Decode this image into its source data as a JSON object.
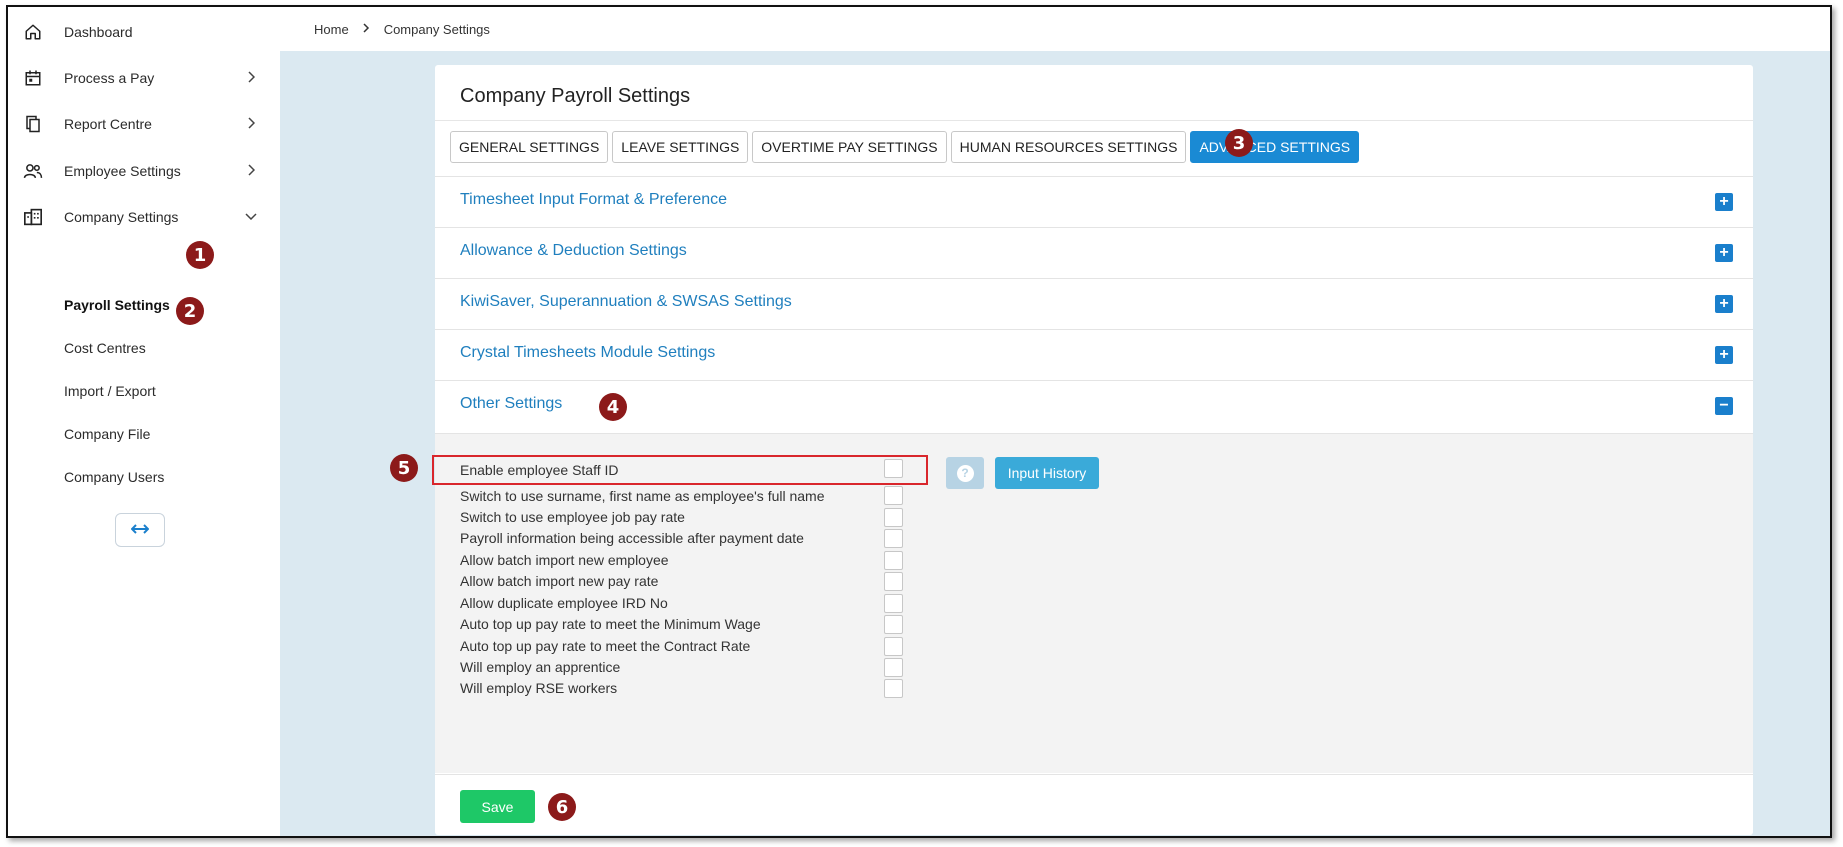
{
  "sidebar": {
    "items": [
      {
        "label": "Dashboard",
        "icon": "home-icon"
      },
      {
        "label": "Process a Pay",
        "icon": "calendar-icon"
      },
      {
        "label": "Report Centre",
        "icon": "documents-icon"
      },
      {
        "label": "Employee Settings",
        "icon": "people-icon"
      },
      {
        "label": "Company Settings",
        "icon": "building-icon"
      }
    ],
    "sub_items": [
      {
        "label": "Payroll Settings"
      },
      {
        "label": "Cost Centres"
      },
      {
        "label": "Import / Export"
      },
      {
        "label": "Company File"
      },
      {
        "label": "Company Users"
      }
    ],
    "collapse_icon": "double-arrow-icon"
  },
  "breadcrumb": {
    "home": "Home",
    "current": "Company Settings"
  },
  "card": {
    "title": "Company Payroll Settings",
    "tabs": [
      {
        "label": "GENERAL SETTINGS"
      },
      {
        "label": "LEAVE SETTINGS"
      },
      {
        "label": "OVERTIME PAY SETTINGS"
      },
      {
        "label": "HUMAN RESOURCES SETTINGS"
      },
      {
        "label": "ADVANCED SETTINGS"
      }
    ],
    "active_tab": "ADVANCED SETTINGS",
    "sections": [
      {
        "title": "Timesheet Input Format & Preference",
        "toggle": "+"
      },
      {
        "title": "Allowance & Deduction Settings",
        "toggle": "+"
      },
      {
        "title": "KiwiSaver, Superannuation & SWSAS Settings",
        "toggle": "+"
      },
      {
        "title": "Crystal Timesheets Module Settings",
        "toggle": "+"
      },
      {
        "title": "Other Settings",
        "toggle": "−"
      }
    ],
    "options": [
      {
        "label": "Enable employee Staff ID",
        "checked": false
      },
      {
        "label": "Switch to use surname, first name as employee's full name",
        "checked": false
      },
      {
        "label": "Switch to use employee job pay rate",
        "checked": false
      },
      {
        "label": "Payroll information being accessible after payment date",
        "checked": false
      },
      {
        "label": "Allow batch import new employee",
        "checked": false
      },
      {
        "label": "Allow batch import new pay rate",
        "checked": false
      },
      {
        "label": "Allow duplicate employee IRD No",
        "checked": false
      },
      {
        "label": "Auto top up pay rate to meet the Minimum Wage",
        "checked": false
      },
      {
        "label": "Auto top up pay rate to meet the Contract Rate",
        "checked": false
      },
      {
        "label": "Will employ an apprentice",
        "checked": false
      },
      {
        "label": "Will employ RSE workers",
        "checked": false
      }
    ],
    "help_label": "?",
    "input_history_label": "Input History",
    "save_label": "Save"
  },
  "markers": [
    "1",
    "2",
    "3",
    "4",
    "5",
    "6"
  ],
  "colors": {
    "accent": "#1a8ad4",
    "link": "#1f7fbe",
    "save": "#1ec867",
    "marker": "#8c1a1a",
    "highlight": "#d9262c",
    "main_bg": "#dbe9f1"
  }
}
